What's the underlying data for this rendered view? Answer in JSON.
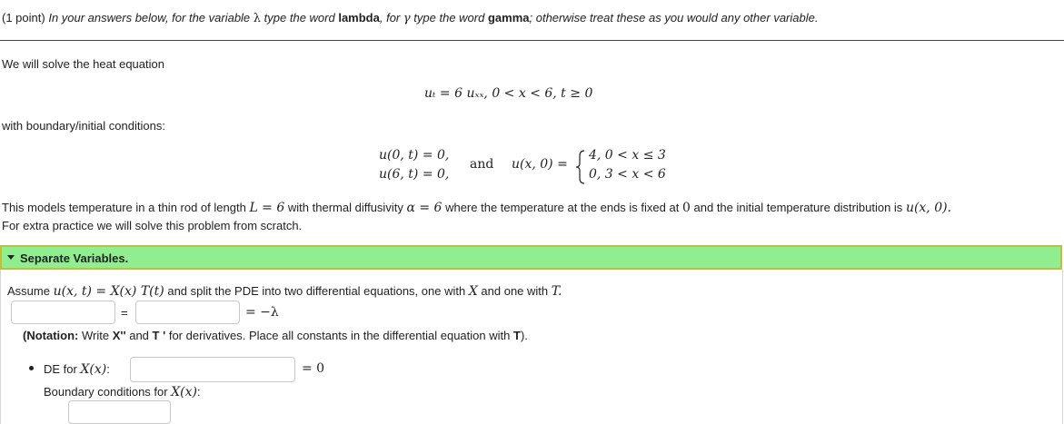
{
  "header": {
    "points": "(1 point)",
    "instruction_a": "In your answers below, for the variable",
    "lambda_symbol": "λ",
    "instruction_b": "type the word",
    "word_lambda": "lambda",
    "instruction_c": ", for",
    "gamma_symbol": "γ",
    "instruction_d": "type the word",
    "word_gamma": "gamma",
    "instruction_e": "; otherwise treat these as you would any other variable."
  },
  "problem": {
    "intro": "We will solve the heat equation",
    "pde": "uₜ = 6 uₓₓ,    0 < x < 6,    t ≥ 0",
    "bc_intro": "with boundary/initial conditions:",
    "bc1": "u(0, t) = 0,",
    "bc2": "u(6, t) = 0,",
    "and_word": "and",
    "ic_lhs": "u(x, 0) =",
    "ic_case1": "4,   0 < x ≤ 3",
    "ic_case2": "0,   3 < x < 6",
    "model_a": "This models temperature in a thin rod of length",
    "model_L": "L = 6",
    "model_b": "with thermal diffusivity",
    "model_alpha": "α = 6",
    "model_c": "where the temperature at the ends is fixed at",
    "model_zero": "0",
    "model_d": "and the initial temperature distribution is",
    "model_u": "u(x, 0).",
    "practice": "For extra practice we will solve this problem from scratch."
  },
  "section": {
    "title": "Separate Variables.",
    "assume_a": "Assume",
    "assume_expr": "u(x, t) = X(x) T(t)",
    "assume_b": "and split the PDE into two differential equations, one with",
    "assume_X": "X",
    "assume_c": "and one with",
    "assume_T": "T.",
    "eq_equals": "=",
    "eq_rhs": "= −λ",
    "notation_label": "(Notation:",
    "notation_a": "Write",
    "notation_X": "X''",
    "notation_b": "and",
    "notation_T": "T '",
    "notation_c": "for derivatives. Place all constants in the differential equation with",
    "notation_T2": "T",
    "notation_end": ").",
    "de_label": "DE for",
    "de_var": "X(x)",
    "de_colon": ":",
    "de_rhs": "= 0",
    "bc_label": "Boundary conditions for",
    "bc_var": "X(x)",
    "bc_colon": ":"
  }
}
